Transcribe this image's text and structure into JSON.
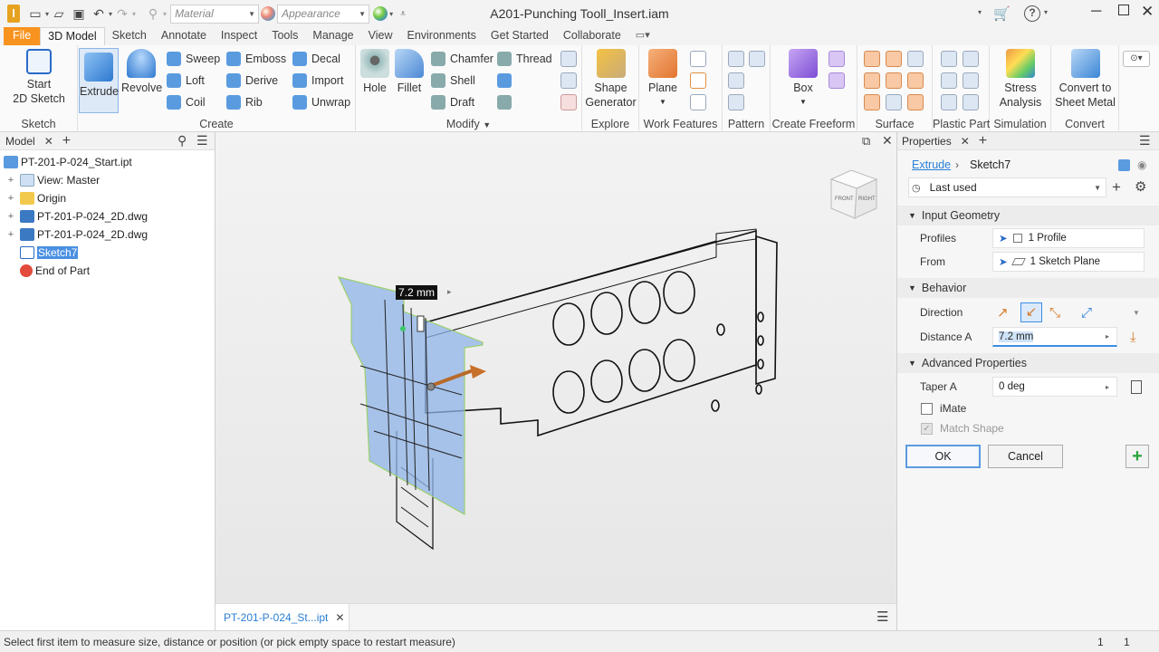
{
  "app": {
    "title": "A201-Punching Tooll_Insert.iam"
  },
  "qat": {
    "material": "Material",
    "appearance": "Appearance"
  },
  "tabs": [
    "File",
    "3D Model",
    "Sketch",
    "Annotate",
    "Inspect",
    "Tools",
    "Manage",
    "View",
    "Environments",
    "Get Started",
    "Collaborate"
  ],
  "ribbon": {
    "start_sketch": "Start\n2D Sketch",
    "sketch_group": "Sketch",
    "extrude": "Extrude",
    "revolve": "Revolve",
    "sweep": "Sweep",
    "loft": "Loft",
    "coil": "Coil",
    "emboss": "Emboss",
    "derive": "Derive",
    "rib": "Rib",
    "decal": "Decal",
    "import": "Import",
    "unwrap": "Unwrap",
    "create_group": "Create",
    "hole": "Hole",
    "fillet": "Fillet",
    "chamfer": "Chamfer",
    "shell": "Shell",
    "draft": "Draft",
    "thread": "Thread",
    "modify_group": "Modify",
    "shape_generator": "Shape\nGenerator",
    "explore_group": "Explore",
    "plane": "Plane",
    "work_features_group": "Work Features",
    "pattern_group": "Pattern",
    "box": "Box",
    "freeform_group": "Create Freeform",
    "surface_group": "Surface",
    "plastic_group": "Plastic Part",
    "stress": "Stress\nAnalysis",
    "simulation_group": "Simulation",
    "convert": "Convert to\nSheet Metal",
    "convert_group": "Convert"
  },
  "model": {
    "header": "Model",
    "items": [
      {
        "label": "PT-201-P-024_Start.ipt",
        "expander": ""
      },
      {
        "label": "View: Master",
        "expander": "+"
      },
      {
        "label": "Origin",
        "expander": "+"
      },
      {
        "label": "PT-201-P-024_2D.dwg",
        "expander": "+"
      },
      {
        "label": "PT-201-P-024_2D.dwg",
        "expander": "+"
      },
      {
        "label": "Sketch7",
        "expander": ""
      },
      {
        "label": "End of Part",
        "expander": ""
      }
    ]
  },
  "viewport": {
    "dimension": "7.2 mm",
    "cube_front": "FRONT",
    "cube_right": "RIGHT"
  },
  "doc_tab": "PT-201-P-024_St...ipt",
  "props": {
    "header": "Properties",
    "crumb_feature": "Extrude",
    "crumb_sketch": "Sketch7",
    "preset": "Last used",
    "input_geometry": "Input Geometry",
    "profiles_label": "Profiles",
    "profiles_value": "1 Profile",
    "from_label": "From",
    "from_value": "1 Sketch Plane",
    "behavior": "Behavior",
    "direction_label": "Direction",
    "distance_label": "Distance A",
    "distance_value": "7.2 mm",
    "advanced": "Advanced Properties",
    "taper_label": "Taper A",
    "taper_value": "0 deg",
    "imate": "iMate",
    "match_shape": "Match Shape",
    "ok": "OK",
    "cancel": "Cancel"
  },
  "status": {
    "text": "Select first item to measure size, distance or position (or pick empty space to restart measure)",
    "count1": "1",
    "count2": "1"
  }
}
